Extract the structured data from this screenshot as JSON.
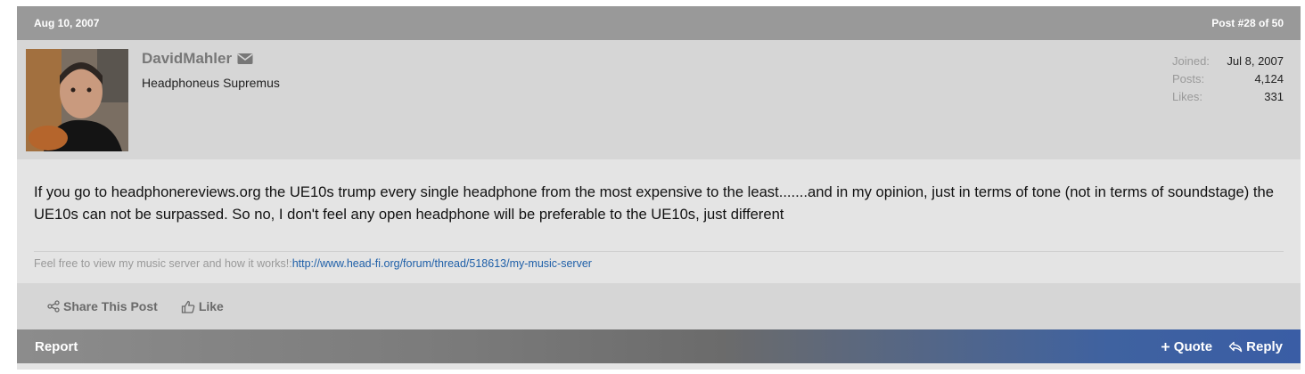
{
  "post": {
    "date": "Aug 10, 2007",
    "counter": "Post #28 of 50"
  },
  "user": {
    "name": "DavidMahler",
    "title": "Headphoneus Supremus",
    "stats": [
      {
        "label": "Joined:",
        "value": "Jul 8, 2007"
      },
      {
        "label": "Posts:",
        "value": "4,124"
      },
      {
        "label": "Likes:",
        "value": "331"
      }
    ]
  },
  "body": {
    "text": "If you go to headphonereviews.org the UE10s trump every single headphone from the most expensive to the least.......and in my opinion, just in terms of tone (not in terms of soundstage) the UE10s can not be surpassed. So no, I don't feel any open headphone will be preferable to the UE10s, just different"
  },
  "signature": {
    "prefix": "Feel free to view my music server and how it works!:",
    "link": "http://www.head-fi.org/forum/thread/518613/my-music-server"
  },
  "actions": {
    "share": "Share This Post",
    "like": "Like"
  },
  "footer": {
    "report": "Report",
    "quote": "Quote",
    "reply": "Reply"
  },
  "icons": {
    "message": "envelope-icon",
    "share": "share-icon",
    "like": "thumbs-up-icon",
    "quote": "plus-icon",
    "reply": "reply-arrow-icon"
  },
  "colors": {
    "header_bg": "#999999",
    "link": "#1e5fa8",
    "footer_accent": "#3a5da5"
  }
}
